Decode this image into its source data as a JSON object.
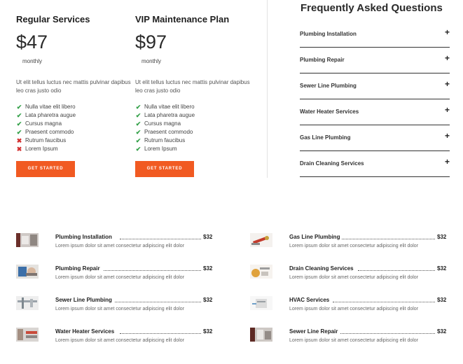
{
  "pricing": {
    "plans": [
      {
        "title": "Regular Services",
        "price": "$47",
        "period": "monthly",
        "description": "Ut elit tellus luctus nec mattis pulvinar dapibus leo cras justo odio",
        "features": [
          {
            "label": "Nulla vitae elit libero",
            "included": true
          },
          {
            "label": "Lata pharetra augue",
            "included": true
          },
          {
            "label": "Cursus magna",
            "included": true
          },
          {
            "label": "Praesent commodo",
            "included": true
          },
          {
            "label": "Rutrum faucibus",
            "included": false
          },
          {
            "label": "Lorem Ipsum",
            "included": false
          }
        ],
        "cta": "GET STARTED"
      },
      {
        "title": "VIP Maintenance Plan",
        "price": "$97",
        "period": "monthly",
        "description": "Ut elit tellus luctus nec mattis pulvinar dapibus leo cras justo odio",
        "features": [
          {
            "label": "Nulla vitae elit libero",
            "included": true
          },
          {
            "label": "Lata pharetra augue",
            "included": true
          },
          {
            "label": "Cursus magna",
            "included": true
          },
          {
            "label": "Praesent commodo",
            "included": true
          },
          {
            "label": "Rutrum faucibus",
            "included": true
          },
          {
            "label": "Lorem Ipsum",
            "included": true
          }
        ],
        "cta": "GET STARTED"
      }
    ],
    "icons": {
      "included": "check-icon",
      "excluded": "cross-icon"
    },
    "colors": {
      "check": "#35a14a",
      "cross": "#d32f2f",
      "cta": "#f15a22"
    }
  },
  "faq": {
    "title": "Frequently Asked Questions",
    "expand_icon": "plus-icon",
    "items": [
      {
        "label": "Plumbing Installation"
      },
      {
        "label": "Plumbing Repair"
      },
      {
        "label": "Sewer Line Plumbing"
      },
      {
        "label": "Water Heater Services"
      },
      {
        "label": "Gas Line Plumbing"
      },
      {
        "label": "Drain Cleaning Services"
      }
    ]
  },
  "services": {
    "left": [
      {
        "name": "Plumbing Installation",
        "price": "$32",
        "description": "Lorem ipsum dolor sit amet consectetur adipiscing elit dolor",
        "thumb": "plumbing-installation-photo"
      },
      {
        "name": "Plumbing Repair",
        "price": "$32",
        "description": "Lorem ipsum dolor sit amet consectetur adipiscing elit dolor",
        "thumb": "plumbing-repair-photo"
      },
      {
        "name": "Sewer Line Plumbing",
        "price": "$32",
        "description": "Lorem ipsum dolor sit amet consectetur adipiscing elit dolor",
        "thumb": "sewer-line-photo"
      },
      {
        "name": "Water Heater Services",
        "price": "$32",
        "description": "Lorem ipsum dolor sit amet consectetur adipiscing elit dolor",
        "thumb": "water-heater-photo"
      }
    ],
    "right": [
      {
        "name": "Gas Line Plumbing",
        "price": "$32",
        "description": "Lorem ipsum dolor sit amet consectetur adipiscing elit dolor",
        "thumb": "gas-line-photo"
      },
      {
        "name": "Drain Cleaning Services",
        "price": "$32",
        "description": "Lorem ipsum dolor sit amet consectetur adipiscing elit dolor",
        "thumb": "drain-cleaning-photo"
      },
      {
        "name": "HVAC Services",
        "price": "$32",
        "description": "Lorem ipsum dolor sit amet consectetur adipiscing elit dolor",
        "thumb": "hvac-photo"
      },
      {
        "name": "Sewer Line Repair",
        "price": "$32",
        "description": "Lorem ipsum dolor sit amet consectetur adipiscing elit dolor",
        "thumb": "sewer-repair-photo"
      }
    ]
  }
}
